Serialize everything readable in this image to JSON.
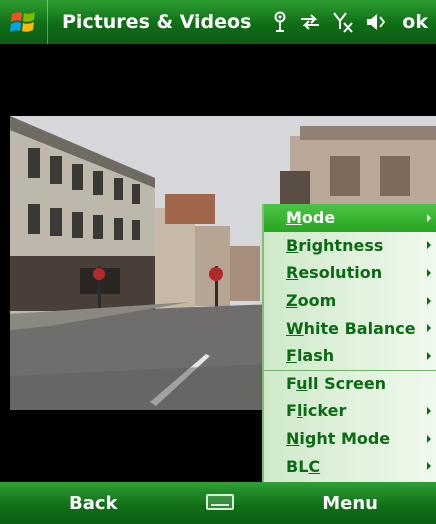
{
  "titlebar": {
    "title": "Pictures & Videos",
    "ok_label": "ok",
    "icons": [
      "windows-start-icon",
      "antenna-icon",
      "sync-icon",
      "no-signal-icon",
      "volume-icon"
    ]
  },
  "menu": {
    "items": [
      {
        "pre": "",
        "ul": "M",
        "post": "ode",
        "has_submenu": true,
        "active": true
      },
      {
        "pre": "",
        "ul": "B",
        "post": "rightness",
        "has_submenu": true
      },
      {
        "pre": "",
        "ul": "R",
        "post": "esolution",
        "has_submenu": true
      },
      {
        "pre": "",
        "ul": "Z",
        "post": "oom",
        "has_submenu": true
      },
      {
        "pre": "",
        "ul": "W",
        "post": "hite Balance",
        "has_submenu": true
      },
      {
        "pre": "",
        "ul": "F",
        "post": "lash",
        "has_submenu": true
      },
      {
        "pre": "F",
        "ul": "u",
        "post": "ll Screen",
        "has_submenu": false
      },
      {
        "pre": "F",
        "ul": "l",
        "post": "icker",
        "has_submenu": true
      },
      {
        "pre": "",
        "ul": "N",
        "post": "ight Mode",
        "has_submenu": true
      },
      {
        "pre": "BL",
        "ul": "C",
        "post": "",
        "has_submenu": true
      }
    ]
  },
  "softkeys": {
    "left": "Back",
    "right": "Menu"
  },
  "colors": {
    "bar_green": "#117018",
    "menu_text": "#0b6a14",
    "menu_active": "#28a522"
  }
}
